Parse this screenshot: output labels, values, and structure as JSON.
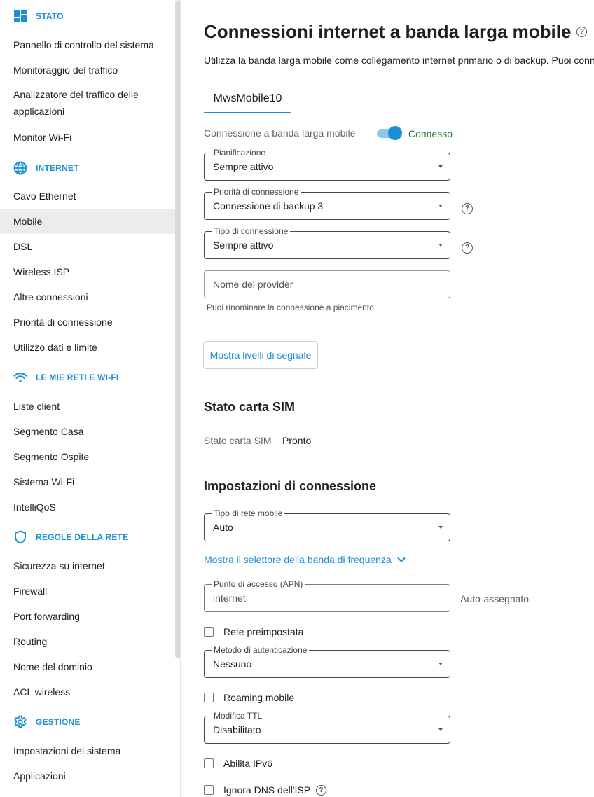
{
  "sidebar": {
    "sections": {
      "stato": "STATO",
      "internet": "INTERNET",
      "reti": "LE MIE RETI E WI-FI",
      "regole": "REGOLE DELLA RETE",
      "gestione": "GESTIONE"
    },
    "items": {
      "pannello": "Pannello di controllo del sistema",
      "monitoraggio": "Monitoraggio del traffico",
      "analizzatore": "Analizzatore del traffico delle applicazioni",
      "monitor_wifi": "Monitor Wi-Fi",
      "cavo": "Cavo Ethernet",
      "mobile": "Mobile",
      "dsl": "DSL",
      "wisp": "Wireless ISP",
      "altre": "Altre connessioni",
      "priorita": "Priorità di connessione",
      "utilizzo": "Utilizzo dati e limite",
      "liste": "Liste client",
      "casa": "Segmento Casa",
      "ospite": "Segmento Ospite",
      "sistema_wifi": "Sistema Wi-Fi",
      "intelliqos": "IntelliQoS",
      "sicurezza": "Sicurezza su internet",
      "firewall": "Firewall",
      "port": "Port forwarding",
      "routing": "Routing",
      "dominio": "Nome del dominio",
      "acl": "ACL wireless",
      "impostazioni": "Impostazioni del sistema",
      "applicazioni": "Applicazioni"
    },
    "active": "mobile"
  },
  "main": {
    "title": "Connessioni internet a banda larga mobile",
    "subtitle": "Utilizza la banda larga mobile come collegamento internet primario o di backup. Puoi conn",
    "tab": "MwsMobile10",
    "connection": {
      "label": "Connessione a banda larga mobile",
      "status": "Connesso",
      "enabled": true
    },
    "pianificazione": {
      "label": "Pianificazione",
      "value": "Sempre attivo"
    },
    "priorita": {
      "label": "Priorità di connessione",
      "value": "Connessione di backup 3"
    },
    "tipo": {
      "label": "Tipo di connessione",
      "value": "Sempre attivo"
    },
    "provider": {
      "placeholder": "Nome del provider",
      "hint": "Puoi rinominare la connessione a piacimento."
    },
    "signal_button": "Mostra livelli di segnale",
    "sim": {
      "heading": "Stato carta SIM",
      "label": "Stato carta SIM",
      "value": "Pronto"
    },
    "settings": {
      "heading": "Impostazioni di connessione",
      "rete_mobile": {
        "label": "Tipo di rete mobile",
        "value": "Auto"
      },
      "band_link": "Mostra il selettore della banda di frequenza",
      "apn": {
        "label": "Punto di accesso (APN)",
        "value": "internet",
        "aux": "Auto-assegnato"
      },
      "rete_preimpostata": {
        "label": "Rete preimpostata",
        "checked": false
      },
      "auth": {
        "label": "Metodo di autenticazione",
        "value": "Nessuno"
      },
      "roaming": {
        "label": "Roaming mobile",
        "checked": false
      },
      "ttl": {
        "label": "Modifica TTL",
        "value": "Disabilitato"
      },
      "ipv6": {
        "label": "Abilita IPv6",
        "checked": false
      },
      "dns": {
        "label": "Ignora DNS dell'ISP",
        "checked": false
      }
    }
  },
  "colors": {
    "accent": "#1a8fd6",
    "success": "#1e7d32",
    "active_bg": "#ececec"
  },
  "icons": [
    "dashboard-icon",
    "globe-icon",
    "wifi-icon",
    "shield-icon",
    "gear-icon",
    "help-icon",
    "chevron-down-icon",
    "caret-down-icon"
  ]
}
